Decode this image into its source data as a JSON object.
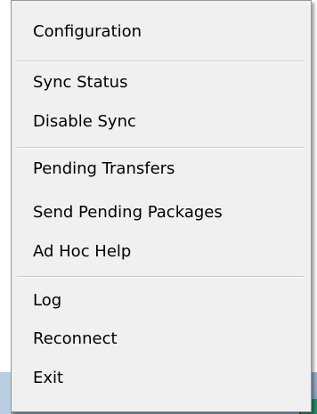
{
  "menu": {
    "groups": [
      {
        "items": [
          {
            "label": "Configuration"
          }
        ]
      },
      {
        "items": [
          {
            "label": "Sync Status"
          },
          {
            "label": "Disable Sync"
          }
        ]
      },
      {
        "items": [
          {
            "label": "Pending Transfers"
          },
          {
            "label": "Send Pending Packages"
          },
          {
            "label": "Ad Hoc Help"
          }
        ]
      },
      {
        "items": [
          {
            "label": "Log"
          },
          {
            "label": "Reconnect"
          },
          {
            "label": "Exit"
          }
        ]
      }
    ]
  },
  "colors": {
    "menu_background": "#f0f0f0",
    "menu_border": "#979797",
    "separator": "#c8c8c8",
    "taskbar": "#9ab4cc",
    "tray_icon": "#2f8a6a"
  }
}
